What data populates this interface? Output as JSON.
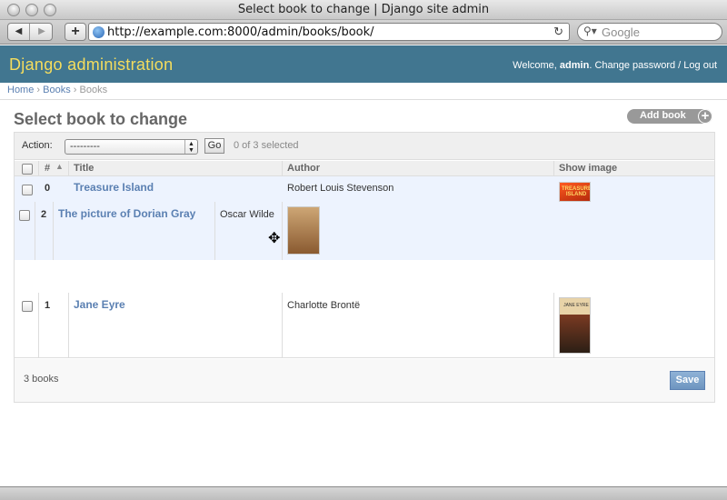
{
  "window": {
    "title": "Select book to change | Django site admin"
  },
  "browser": {
    "url": "http://example.com:8000/admin/books/book/",
    "search_placeholder": "Google"
  },
  "header": {
    "branding": "Django administration",
    "welcome": "Welcome,",
    "username": "admin",
    "change_password": "Change password",
    "separator": "/",
    "logout": "Log out"
  },
  "breadcrumbs": {
    "home": "Home",
    "app": "Books",
    "current": "Books",
    "sep": "›"
  },
  "page": {
    "title": "Select book to change",
    "add_button": "Add book"
  },
  "actions": {
    "label": "Action:",
    "selected": "---------",
    "go": "Go",
    "selection_count": "0 of 3 selected"
  },
  "columns": {
    "index": "#",
    "title": "Title",
    "author": "Author",
    "image": "Show image"
  },
  "rows": [
    {
      "index": "0",
      "title": "Treasure Island",
      "author": "Robert Louis Stevenson",
      "cover_text": "TREASURE ISLAND",
      "cover_color": "#e84a18"
    },
    {
      "index": "2",
      "title": "The picture of Dorian Gray",
      "author": "Oscar Wilde",
      "cover_text": "",
      "cover_color": "#b08050"
    },
    {
      "index": "1",
      "title": "Jane Eyre",
      "author": "Charlotte Brontë",
      "cover_text": "JANE EYRE",
      "cover_color": "#5a2a18"
    }
  ],
  "footer": {
    "result_count": "3 books",
    "save": "Save"
  },
  "colors": {
    "header_bg": "#417690",
    "branding": "#f5dd5d",
    "link": "#5b80b2",
    "row_highlight": "#edf3fe"
  }
}
